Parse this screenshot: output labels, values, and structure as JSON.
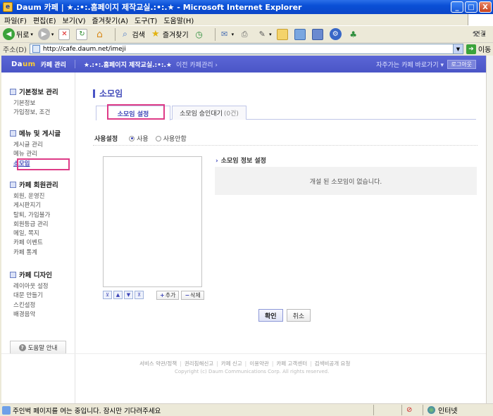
{
  "window": {
    "title": "Daum 카페 | ★.:•:.홈페이지 제작교실.:•:.★ - Microsoft Internet Explorer",
    "minimize": "_",
    "maximize": "□",
    "close": "X"
  },
  "menu": [
    "파일(F)",
    "편집(E)",
    "보기(V)",
    "즐겨찾기(A)",
    "도구(T)",
    "도움말(H)"
  ],
  "toolbar": {
    "back": "뒤로",
    "search": "검색",
    "favorites": "즐겨찾기"
  },
  "address": {
    "label": "주소(D)",
    "url": "http://cafe.daum.net/imeji",
    "go": "이동",
    "links": "연결"
  },
  "header": {
    "logo_a": "Da",
    "logo_b": "um",
    "cafe_mgmt": "카페 관리",
    "cafe_name": "★.:•:.홈페이지 제작교실.:•:.★",
    "prev_mgmt": "이전 카페관리 ›",
    "quick_cafe": "자주가는 카페 바로가기 ▾",
    "logout": "로그아웃"
  },
  "sidebar": {
    "sections": [
      {
        "title": "기본정보 관리",
        "items": [
          "기본정보",
          "가입정보, 조건"
        ]
      },
      {
        "title": "메뉴 및 게시글",
        "items": [
          "게시글 관리",
          "메뉴 관리",
          "소모임"
        ]
      },
      {
        "title": "카페 회원관리",
        "items": [
          "회원, 운영진",
          "게시판지기",
          "탈퇴, 가입불가",
          "회원등급 관리",
          "메일, 쪽지",
          "카페 이벤트",
          "카페 통계"
        ]
      },
      {
        "title": "카페 디자인",
        "items": [
          "레이아웃 설정",
          "대문 만들기",
          "스킨설정",
          "배경음악"
        ]
      }
    ],
    "help": "도움말 안내"
  },
  "main": {
    "title": "소모임",
    "tabs": [
      {
        "label": "소모임 설정"
      },
      {
        "label": "소모임 승인대기",
        "count": "(0건)"
      }
    ],
    "usage_label": "사용설정",
    "usage_on": "사용",
    "usage_off": "사용안함",
    "order_buttons": [
      "⊻",
      "▲",
      "▼",
      "⊼"
    ],
    "add": "추가",
    "delete": "삭제",
    "info_title": "소모임 정보 설정",
    "empty_message": "개설 된 소모임이 없습니다.",
    "confirm": "확인",
    "cancel": "취소"
  },
  "footer": {
    "links": [
      "서비스 약관/정책",
      "권리침해신고",
      "카페 신고",
      "이용약관",
      "카페 고객센터",
      "검색비공개 요청"
    ],
    "copyright": "Copyright (c) Daum Communications Corp. All rights reserved."
  },
  "status": {
    "message": "주인벅 페이지를 여는 중입니다. 잠시만 기다려주세요",
    "zone": "인터넷"
  }
}
